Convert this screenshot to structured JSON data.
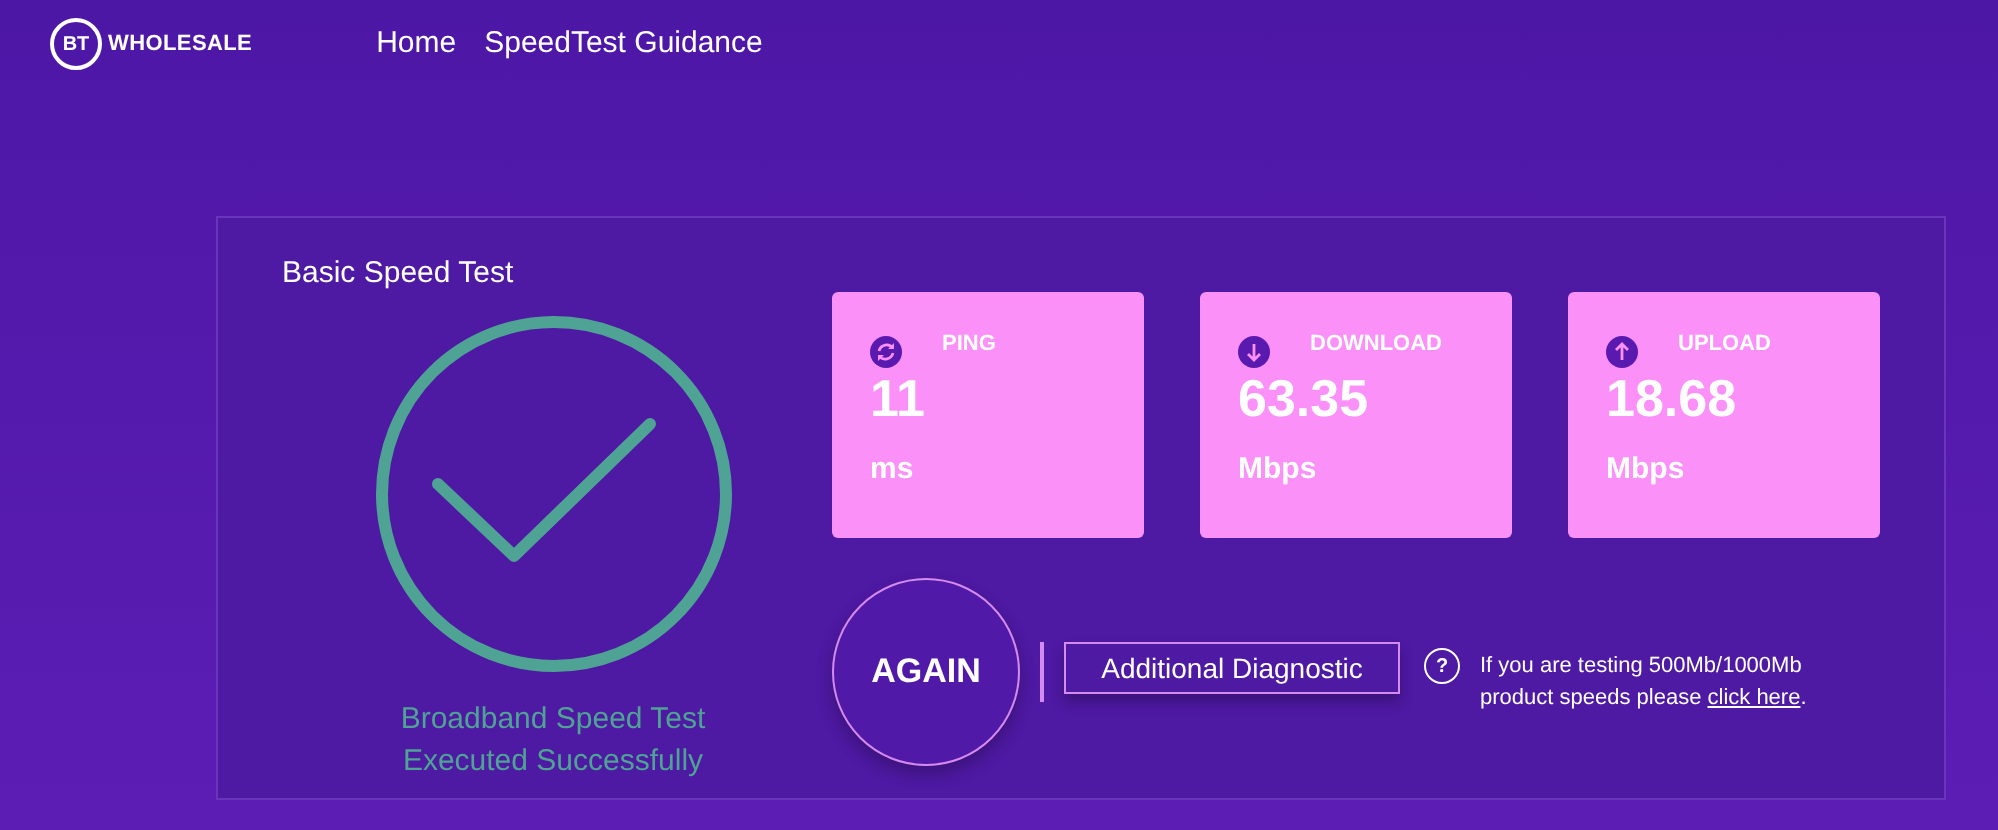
{
  "header": {
    "logo": {
      "mark": "BT",
      "name": "WHOLESALE"
    },
    "nav": [
      "Home",
      "SpeedTest Guidance"
    ]
  },
  "panel": {
    "title": "Basic Speed Test",
    "status": {
      "ok": true,
      "lines": [
        "Broadband Speed Test",
        "Executed Successfully"
      ]
    },
    "metrics": [
      {
        "kind": "ping",
        "label": "PING",
        "value": "11",
        "unit": "ms"
      },
      {
        "kind": "download",
        "label": "DOWNLOAD",
        "value": "63.35",
        "unit": "Mbps"
      },
      {
        "kind": "upload",
        "label": "UPLOAD",
        "value": "18.68",
        "unit": "Mbps"
      }
    ],
    "again_button": "AGAIN",
    "diagnostic_button": "Additional Diagnostic",
    "help_icon": "?",
    "note": {
      "text": "If you are testing 500Mb/1000Mb product speeds please",
      "link": "click here",
      "after": "."
    }
  }
}
